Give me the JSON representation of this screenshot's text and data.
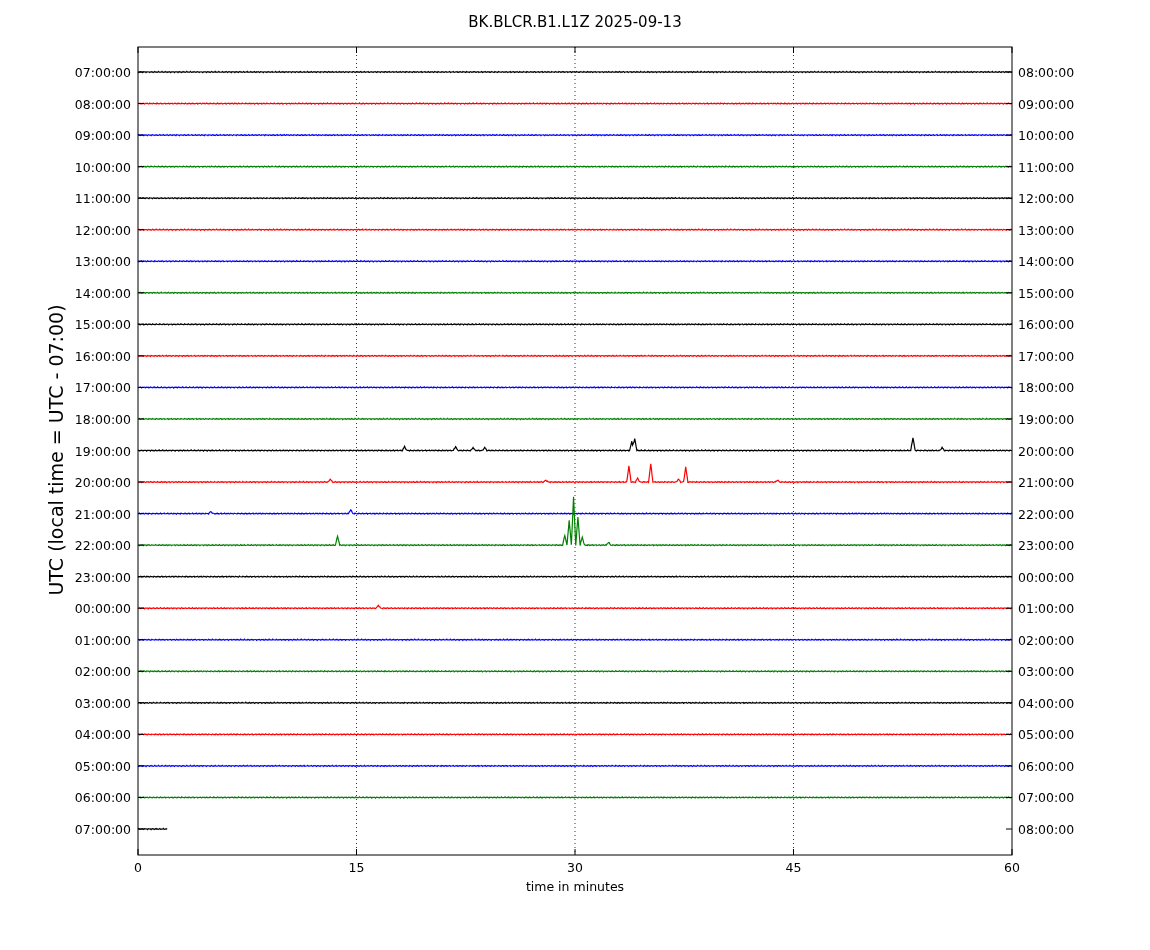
{
  "title": "BK.BLCR.B1.L1Z 2025-09-13",
  "y_axis_label": "UTC (local time = UTC - 07:00)",
  "x_axis_label": "time in minutes",
  "x_ticks": [
    "0",
    "15",
    "30",
    "45",
    "60"
  ],
  "rows": [
    {
      "left": "07:00:00",
      "right": "08:00:00",
      "color": "#000000",
      "kind": "full"
    },
    {
      "left": "08:00:00",
      "right": "09:00:00",
      "color": "#ff0000",
      "kind": "full"
    },
    {
      "left": "09:00:00",
      "right": "10:00:00",
      "color": "#0000ff",
      "kind": "full"
    },
    {
      "left": "10:00:00",
      "right": "11:00:00",
      "color": "#008000",
      "kind": "full"
    },
    {
      "left": "11:00:00",
      "right": "12:00:00",
      "color": "#000000",
      "kind": "full"
    },
    {
      "left": "12:00:00",
      "right": "13:00:00",
      "color": "#ff0000",
      "kind": "full"
    },
    {
      "left": "13:00:00",
      "right": "14:00:00",
      "color": "#0000ff",
      "kind": "full"
    },
    {
      "left": "14:00:00",
      "right": "15:00:00",
      "color": "#008000",
      "kind": "full"
    },
    {
      "left": "15:00:00",
      "right": "16:00:00",
      "color": "#000000",
      "kind": "full"
    },
    {
      "left": "16:00:00",
      "right": "17:00:00",
      "color": "#ff0000",
      "kind": "full"
    },
    {
      "left": "17:00:00",
      "right": "18:00:00",
      "color": "#0000ff",
      "kind": "full"
    },
    {
      "left": "18:00:00",
      "right": "19:00:00",
      "color": "#008000",
      "kind": "full"
    },
    {
      "left": "19:00:00",
      "right": "20:00:00",
      "color": "#000000",
      "kind": "full"
    },
    {
      "left": "20:00:00",
      "right": "21:00:00",
      "color": "#ff0000",
      "kind": "full"
    },
    {
      "left": "21:00:00",
      "right": "22:00:00",
      "color": "#0000ff",
      "kind": "full"
    },
    {
      "left": "22:00:00",
      "right": "23:00:00",
      "color": "#008000",
      "kind": "full"
    },
    {
      "left": "23:00:00",
      "right": "00:00:00",
      "color": "#000000",
      "kind": "full"
    },
    {
      "left": "00:00:00",
      "right": "01:00:00",
      "color": "#ff0000",
      "kind": "full"
    },
    {
      "left": "01:00:00",
      "right": "02:00:00",
      "color": "#0000ff",
      "kind": "full"
    },
    {
      "left": "02:00:00",
      "right": "03:00:00",
      "color": "#008000",
      "kind": "full"
    },
    {
      "left": "03:00:00",
      "right": "04:00:00",
      "color": "#000000",
      "kind": "full"
    },
    {
      "left": "04:00:00",
      "right": "05:00:00",
      "color": "#ff0000",
      "kind": "full"
    },
    {
      "left": "05:00:00",
      "right": "06:00:00",
      "color": "#0000ff",
      "kind": "full"
    },
    {
      "left": "06:00:00",
      "right": "07:00:00",
      "color": "#008000",
      "kind": "full"
    },
    {
      "left": "07:00:00",
      "right": "08:00:00",
      "color": "#000000",
      "kind": "partial"
    }
  ]
}
